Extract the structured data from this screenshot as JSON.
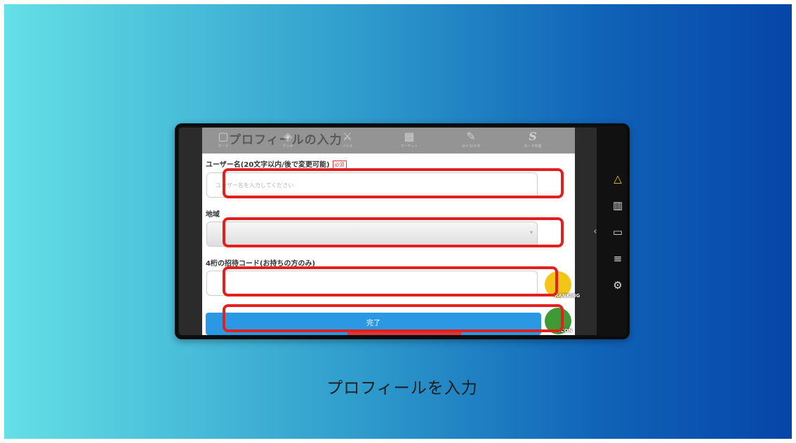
{
  "screen": {
    "page_title": "プロフィールの入力",
    "nav": [
      {
        "icon": "card-icon",
        "glyph": "▢",
        "label": "カード"
      },
      {
        "icon": "deck-icon",
        "glyph": "◈",
        "label": "デッキ"
      },
      {
        "icon": "battle-icon",
        "glyph": "⚔",
        "label": "バトル"
      },
      {
        "icon": "shop-icon",
        "glyph": "▦",
        "label": "マーケット"
      },
      {
        "icon": "pen-icon",
        "glyph": "✎",
        "label": "ボイス/メモ"
      },
      {
        "icon": "s-logo-icon",
        "glyph": "S",
        "label": "カード作成"
      }
    ],
    "form": {
      "username_label": "ユーザー名(20文字以内/後で変更可能)",
      "required_badge": "必須",
      "username_placeholder": "ユーザー名を入力してください",
      "region_label": "地域",
      "invite_label": "4桁の招待コード(お持ちの方のみ)",
      "submit_label": "完了"
    },
    "floating": {
      "ranking_caption": "RANKING",
      "icon_caption": "ICON"
    }
  },
  "sidebar_icons": [
    "triangle-icon",
    "map-icon",
    "wallet-icon",
    "menu-icon",
    "gear-icon",
    "chevron-left-icon"
  ],
  "caption": "プロフィールを入力",
  "colors": {
    "highlight": "#e41f1f",
    "submit": "#2a98e2",
    "accent": "#f2c518"
  }
}
